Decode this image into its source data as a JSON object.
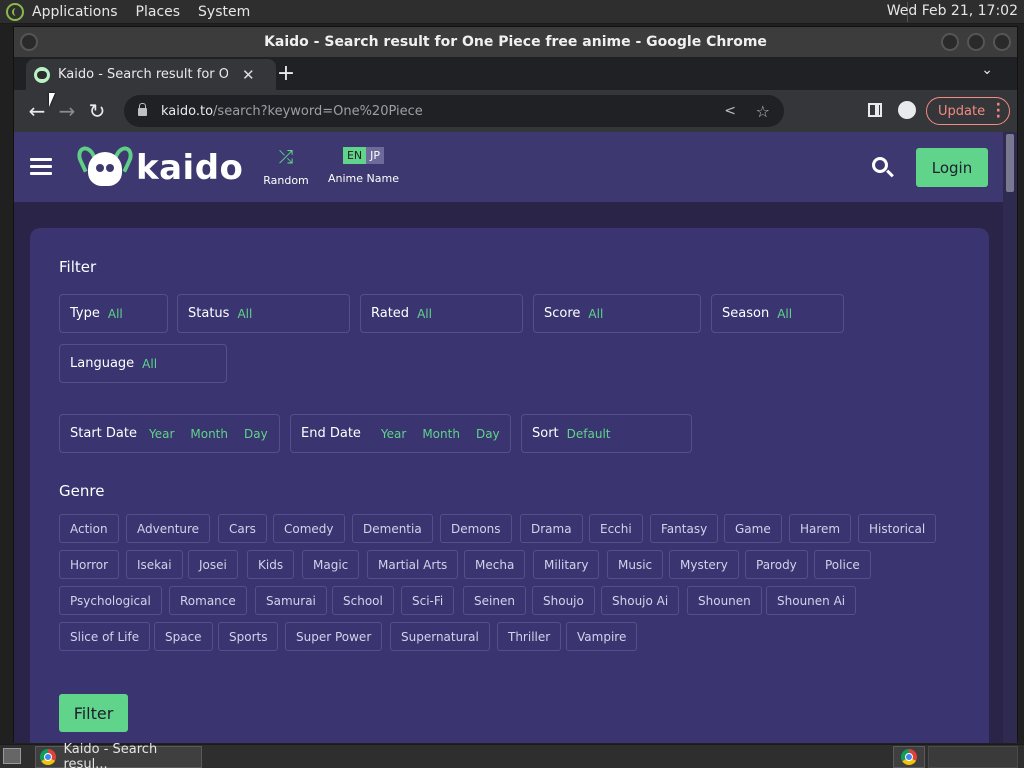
{
  "system_panel": {
    "menus": [
      "Applications",
      "Places",
      "System"
    ],
    "clock": "Wed Feb 21, 17:02"
  },
  "window": {
    "title": "Kaido - Search result for One Piece free anime - Google Chrome"
  },
  "browser": {
    "tab_title": "Kaido - Search result for One Piece free anime",
    "tab_close": "✕",
    "new_tab": "+",
    "tab_menu": "⌄",
    "url_host": "kaido.to",
    "url_path": "/search?keyword=One%20Piece",
    "update_label": "Update",
    "back": "←",
    "forward": "→",
    "reload": "↻"
  },
  "site": {
    "brand": "kaido",
    "random_label": "Random",
    "lang_en": "EN",
    "lang_jp": "JP",
    "anime_name_label": "Anime Name",
    "login_label": "Login"
  },
  "filter": {
    "title": "Filter",
    "type": {
      "label": "Type",
      "value": "All"
    },
    "status": {
      "label": "Status",
      "value": "All"
    },
    "rated": {
      "label": "Rated",
      "value": "All"
    },
    "score": {
      "label": "Score",
      "value": "All"
    },
    "season": {
      "label": "Season",
      "value": "All"
    },
    "language": {
      "label": "Language",
      "value": "All"
    },
    "start_date": {
      "label": "Start Date",
      "year": "Year",
      "month": "Month",
      "day": "Day"
    },
    "end_date": {
      "label": "End Date",
      "year": "Year",
      "month": "Month",
      "day": "Day"
    },
    "sort": {
      "label": "Sort",
      "value": "Default"
    },
    "genre_title": "Genre",
    "genres": [
      "Action",
      "Adventure",
      "Cars",
      "Comedy",
      "Dementia",
      "Demons",
      "Drama",
      "Ecchi",
      "Fantasy",
      "Game",
      "Harem",
      "Historical",
      "Horror",
      "Isekai",
      "Josei",
      "Kids",
      "Magic",
      "Martial Arts",
      "Mecha",
      "Military",
      "Music",
      "Mystery",
      "Parody",
      "Police",
      "Psychological",
      "Romance",
      "Samurai",
      "School",
      "Sci-Fi",
      "Seinen",
      "Shoujo",
      "Shoujo Ai",
      "Shounen",
      "Shounen Ai",
      "Slice of Life",
      "Space",
      "Sports",
      "Super Power",
      "Supernatural",
      "Thriller",
      "Vampire"
    ],
    "button_label": "Filter"
  },
  "taskbar": {
    "task_label": "Kaido - Search resul..."
  },
  "colors": {
    "accent": "#5fd48a",
    "header_bg": "#3e3870",
    "page_bg": "#2a2548",
    "panel_bg": "#3a3470"
  }
}
